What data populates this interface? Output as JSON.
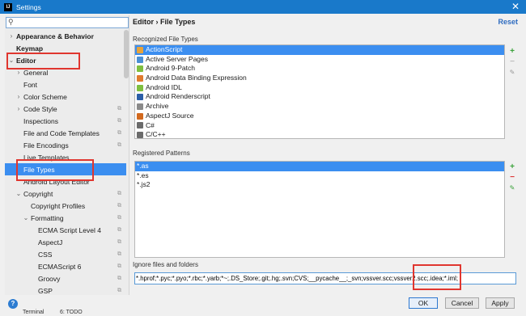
{
  "window": {
    "title": "Settings",
    "app_icon": "IJ"
  },
  "search": {
    "placeholder": "",
    "value": ""
  },
  "tree": [
    {
      "label": "Appearance & Behavior",
      "bold": true,
      "arrow": "right",
      "indent": 0,
      "gear": false
    },
    {
      "label": "Keymap",
      "bold": true,
      "arrow": "",
      "indent": 0,
      "gear": false
    },
    {
      "label": "Editor",
      "bold": true,
      "arrow": "down",
      "indent": 0,
      "gear": false
    },
    {
      "label": "General",
      "bold": false,
      "arrow": "right",
      "indent": 1,
      "gear": false
    },
    {
      "label": "Font",
      "bold": false,
      "arrow": "",
      "indent": 1,
      "gear": false
    },
    {
      "label": "Color Scheme",
      "bold": false,
      "arrow": "right",
      "indent": 1,
      "gear": false
    },
    {
      "label": "Code Style",
      "bold": false,
      "arrow": "right",
      "indent": 1,
      "gear": true
    },
    {
      "label": "Inspections",
      "bold": false,
      "arrow": "",
      "indent": 1,
      "gear": true
    },
    {
      "label": "File and Code Templates",
      "bold": false,
      "arrow": "",
      "indent": 1,
      "gear": true
    },
    {
      "label": "File Encodings",
      "bold": false,
      "arrow": "",
      "indent": 1,
      "gear": true
    },
    {
      "label": "Live Templates",
      "bold": false,
      "arrow": "",
      "indent": 1,
      "gear": false
    },
    {
      "label": "File Types",
      "bold": false,
      "arrow": "",
      "indent": 1,
      "gear": false,
      "selected": true
    },
    {
      "label": "Android Layout Editor",
      "bold": false,
      "arrow": "",
      "indent": 1,
      "gear": false
    },
    {
      "label": "Copyright",
      "bold": false,
      "arrow": "down",
      "indent": 1,
      "gear": true
    },
    {
      "label": "Copyright Profiles",
      "bold": false,
      "arrow": "",
      "indent": 2,
      "gear": true
    },
    {
      "label": "Formatting",
      "bold": false,
      "arrow": "down",
      "indent": 2,
      "gear": true
    },
    {
      "label": "ECMA Script Level 4",
      "bold": false,
      "arrow": "",
      "indent": 3,
      "gear": true
    },
    {
      "label": "AspectJ",
      "bold": false,
      "arrow": "",
      "indent": 3,
      "gear": true
    },
    {
      "label": "CSS",
      "bold": false,
      "arrow": "",
      "indent": 3,
      "gear": true
    },
    {
      "label": "ECMAScript 6",
      "bold": false,
      "arrow": "",
      "indent": 3,
      "gear": true
    },
    {
      "label": "Groovy",
      "bold": false,
      "arrow": "",
      "indent": 3,
      "gear": true
    },
    {
      "label": "GSP",
      "bold": false,
      "arrow": "",
      "indent": 3,
      "gear": true
    }
  ],
  "main": {
    "breadcrumb": "Editor › File Types",
    "reset": "Reset",
    "recognized_label": "Recognized File Types",
    "file_types": [
      {
        "label": "ActionScript",
        "color": "#e8a33a",
        "selected": true
      },
      {
        "label": "Active Server Pages",
        "color": "#4a8fd4"
      },
      {
        "label": "Android 9-Patch",
        "color": "#7fbf3f"
      },
      {
        "label": "Android Data Binding Expression",
        "color": "#e07b2e"
      },
      {
        "label": "Android IDL",
        "color": "#7fbf3f"
      },
      {
        "label": "Android Renderscript",
        "color": "#2b5ea7"
      },
      {
        "label": "Archive",
        "color": "#8a8a8a"
      },
      {
        "label": "AspectJ Source",
        "color": "#d2691e"
      },
      {
        "label": "C#",
        "color": "#6b6b6b"
      },
      {
        "label": "C/C++",
        "color": "#6b6b6b"
      }
    ],
    "patterns_label": "Registered Patterns",
    "patterns": [
      {
        "label": "*.as",
        "selected": true
      },
      {
        "label": "*.es"
      },
      {
        "label": "*.js2"
      }
    ],
    "ignore_label": "Ignore files and folders",
    "ignore_value": "*.hprof;*.pyc;*.pyo;*.rbc;*.yarb;*~;.DS_Store;.git;.hg;.svn;CVS;__pycache__;_svn;vssver.scc;vssver2.scc;.idea;*.iml;"
  },
  "buttons": {
    "ok": "OK",
    "cancel": "Cancel",
    "apply": "Apply",
    "help": "?"
  },
  "behind_text": [
    "Terminal",
    "6: TODO"
  ],
  "icons": {
    "close": "close-icon",
    "search": "search-icon",
    "gear": "gear-icon",
    "add": "plus-icon",
    "remove": "minus-icon",
    "edit": "pencil-icon",
    "help": "help-icon"
  },
  "colors": {
    "titlebar": "#1979ca",
    "selection": "#3b8ef0",
    "annotation": "#e0362f",
    "link": "#2f6cc0"
  }
}
